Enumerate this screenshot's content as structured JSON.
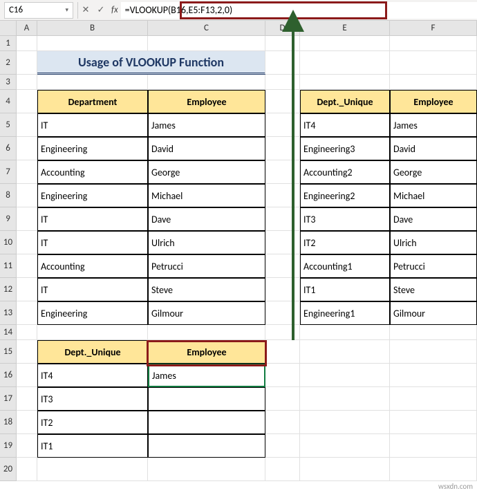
{
  "nameBox": "C16",
  "formula": "=VLOOKUP(B16,E5:F13,2,0)",
  "columns": [
    "A",
    "B",
    "C",
    "D",
    "E",
    "F"
  ],
  "rows": [
    "1",
    "2",
    "3",
    "4",
    "5",
    "6",
    "7",
    "8",
    "9",
    "10",
    "11",
    "12",
    "13",
    "14",
    "15",
    "16",
    "17",
    "18",
    "19",
    "20"
  ],
  "title": "Usage of VLOOKUP Function",
  "table1": {
    "headers": [
      "Department",
      "Employee"
    ],
    "rows": [
      [
        "IT",
        "James"
      ],
      [
        "Engineering",
        "David"
      ],
      [
        "Accounting",
        "George"
      ],
      [
        "Engineering",
        "Michael"
      ],
      [
        "IT",
        "Dave"
      ],
      [
        "IT",
        "Ulrich"
      ],
      [
        "Accounting",
        "Petrucci"
      ],
      [
        "IT",
        "Steve"
      ],
      [
        "Engineering",
        "Gilmour"
      ]
    ]
  },
  "table2": {
    "headers": [
      "Dept._Unique",
      "Employee"
    ],
    "rows": [
      [
        "IT4",
        "James"
      ],
      [
        "Engineering3",
        "David"
      ],
      [
        "Accounting2",
        "George"
      ],
      [
        "Engineering2",
        "Michael"
      ],
      [
        "IT3",
        "Dave"
      ],
      [
        "IT2",
        "Ulrich"
      ],
      [
        "Accounting1",
        "Petrucci"
      ],
      [
        "IT1",
        "Steve"
      ],
      [
        "Engineering1",
        "Gilmour"
      ]
    ]
  },
  "table3": {
    "headers": [
      "Dept._Unique",
      "Employee"
    ],
    "rows": [
      [
        "IT4",
        "James"
      ],
      [
        "IT3",
        ""
      ],
      [
        "IT2",
        ""
      ],
      [
        "IT1",
        ""
      ]
    ]
  },
  "watermark": "wsxdn.com"
}
